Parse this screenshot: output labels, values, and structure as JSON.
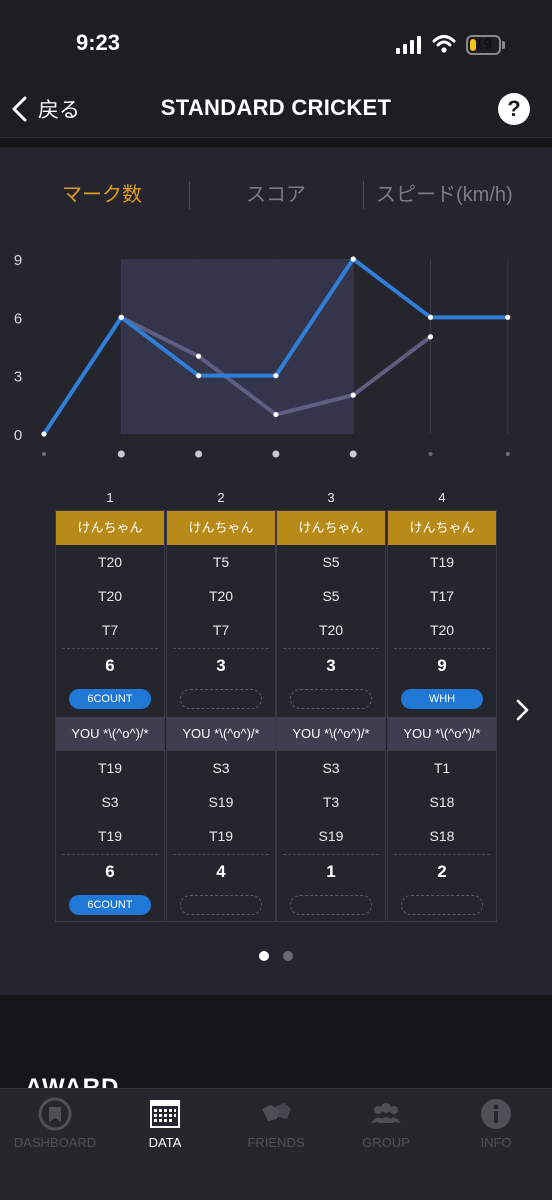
{
  "status_bar": {
    "time": "9:23",
    "battery": "19",
    "battery_level": 0.19
  },
  "nav": {
    "back_label": "戻る",
    "title": "STANDARD CRICKET",
    "help_label": "?"
  },
  "tabs": [
    {
      "label": "マーク数",
      "active": true
    },
    {
      "label": "スコア",
      "active": false
    },
    {
      "label": "スピード(km/h)",
      "active": false
    }
  ],
  "chart_data": {
    "type": "line",
    "x": [
      0,
      1,
      2,
      3,
      4,
      5,
      6
    ],
    "ylim": [
      0,
      9
    ],
    "yticks": [
      "0",
      "3",
      "6",
      "9"
    ],
    "highlight_rounds": [
      1,
      4
    ],
    "series": [
      {
        "values": [
          0,
          6,
          3,
          3,
          9,
          6,
          6
        ],
        "color": "#2f7fd9"
      },
      {
        "values": [
          null,
          6,
          4,
          1,
          2,
          5,
          null
        ],
        "color": "#5e5e82"
      }
    ]
  },
  "rounds": [
    {
      "number": "1",
      "p1": {
        "name": "けんちゃん",
        "darts": [
          "T20",
          "T20",
          "T7"
        ],
        "total": "6",
        "award": "6COUNT"
      },
      "p2": {
        "name": "YOU *\\(^o^)/*",
        "darts": [
          "T19",
          "S3",
          "T19"
        ],
        "total": "6",
        "award": "6COUNT"
      }
    },
    {
      "number": "2",
      "p1": {
        "name": "けんちゃん",
        "darts": [
          "T5",
          "T20",
          "T7"
        ],
        "total": "3",
        "award": ""
      },
      "p2": {
        "name": "YOU *\\(^o^)/*",
        "darts": [
          "S3",
          "S19",
          "T19"
        ],
        "total": "4",
        "award": ""
      }
    },
    {
      "number": "3",
      "p1": {
        "name": "けんちゃん",
        "darts": [
          "S5",
          "S5",
          "T20"
        ],
        "total": "3",
        "award": ""
      },
      "p2": {
        "name": "YOU *\\(^o^)/*",
        "darts": [
          "S3",
          "T3",
          "S19"
        ],
        "total": "1",
        "award": ""
      }
    },
    {
      "number": "4",
      "p1": {
        "name": "けんちゃん",
        "darts": [
          "T19",
          "T17",
          "T20"
        ],
        "total": "9",
        "award": "WHH"
      },
      "p2": {
        "name": "YOU *\\(^o^)/*",
        "darts": [
          "T1",
          "S18",
          "S18"
        ],
        "total": "2",
        "award": ""
      }
    }
  ],
  "pager": {
    "pages": 2,
    "current": 1
  },
  "award_section": {
    "title": "AWARD"
  },
  "tab_bar": [
    {
      "label": "DASHBOARD",
      "icon": "dashboard-icon",
      "active": false
    },
    {
      "label": "DATA",
      "icon": "data-icon",
      "active": true
    },
    {
      "label": "FRIENDS",
      "icon": "friends-icon",
      "active": false
    },
    {
      "label": "GROUP",
      "icon": "group-icon",
      "active": false
    },
    {
      "label": "INFO",
      "icon": "info-icon",
      "active": false
    }
  ],
  "colors": {
    "accent": "#e09a1e",
    "blue": "#1f78d6",
    "gold": "#b88a17"
  }
}
